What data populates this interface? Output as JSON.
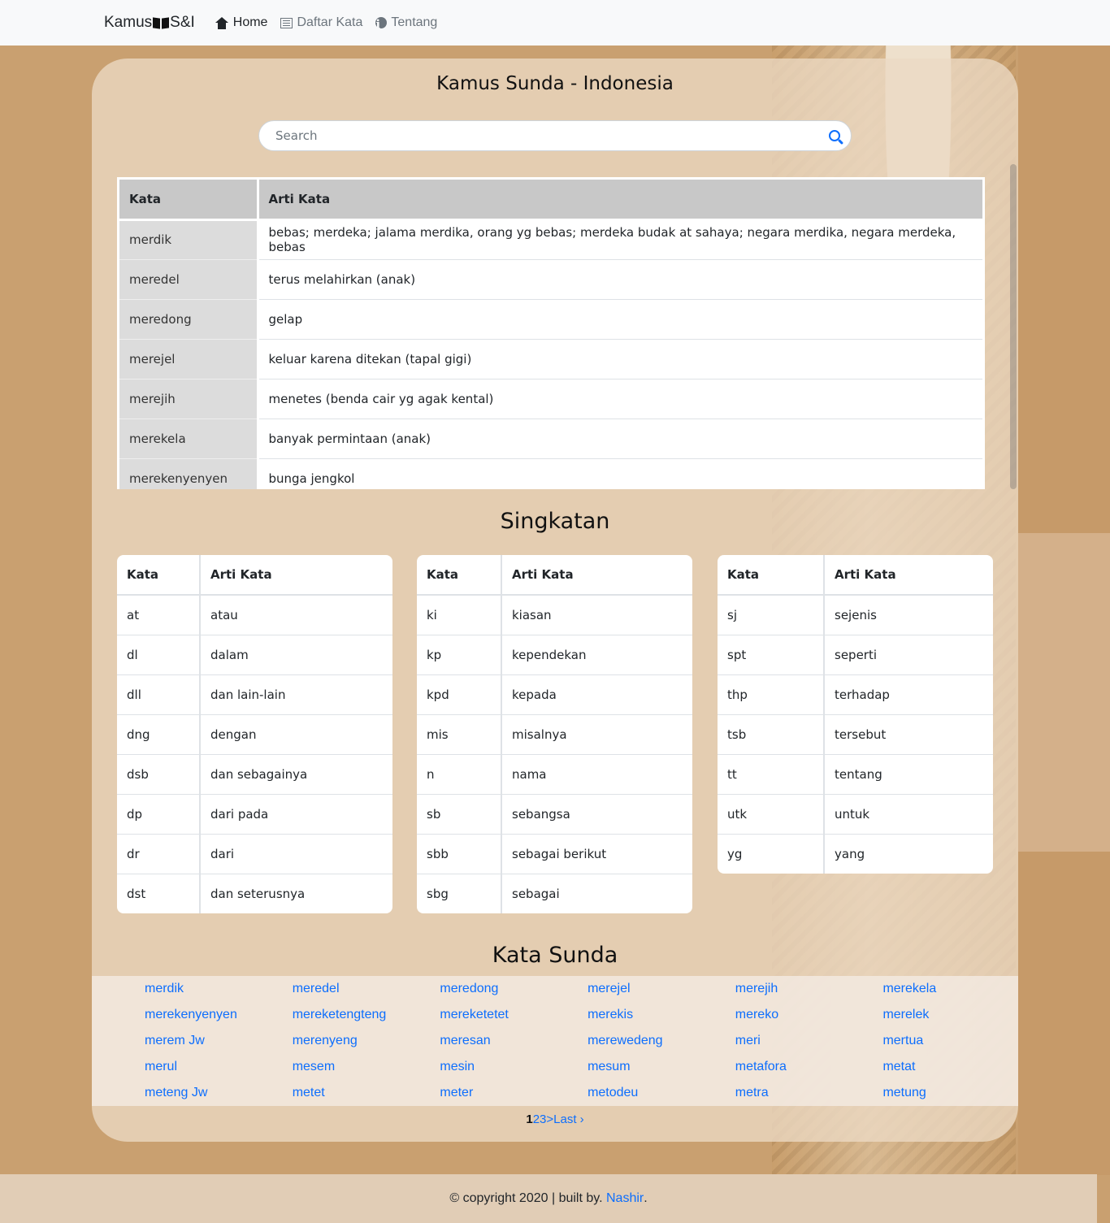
{
  "nav": {
    "brand_left": "Kamus",
    "brand_right": "S&I",
    "links": [
      {
        "label": "Home",
        "icon": "home-icon"
      },
      {
        "label": "Daftar Kata",
        "icon": "list-icon"
      },
      {
        "label": "Tentang",
        "icon": "info-icon"
      }
    ]
  },
  "main": {
    "title": "Kamus Sunda - Indonesia",
    "search_placeholder": "Search",
    "dict": {
      "headers": [
        "Kata",
        "Arti Kata"
      ],
      "rows": [
        [
          "merdik",
          "bebas; merdeka; jalama merdika, orang yg bebas; merdeka budak at sahaya; negara merdika, negara merdeka, bebas"
        ],
        [
          "meredel",
          "terus melahirkan (anak)"
        ],
        [
          "meredong",
          "gelap"
        ],
        [
          "merejel",
          "keluar karena ditekan (tapal gigi)"
        ],
        [
          "merejih",
          "menetes (benda cair yg agak kental)"
        ],
        [
          "merekela",
          "banyak permintaan (anak)"
        ],
        [
          "merekenyenyen",
          "bunga jengkol"
        ]
      ]
    }
  },
  "singkatan": {
    "title": "Singkatan",
    "headers": [
      "Kata",
      "Arti Kata"
    ],
    "tables": [
      [
        [
          "at",
          "atau"
        ],
        [
          "dl",
          "dalam"
        ],
        [
          "dll",
          "dan lain-lain"
        ],
        [
          "dng",
          "dengan"
        ],
        [
          "dsb",
          "dan sebagainya"
        ],
        [
          "dp",
          "dari pada"
        ],
        [
          "dr",
          "dari"
        ],
        [
          "dst",
          "dan seterusnya"
        ]
      ],
      [
        [
          "ki",
          "kiasan"
        ],
        [
          "kp",
          "kependekan"
        ],
        [
          "kpd",
          "kepada"
        ],
        [
          "mis",
          "misalnya"
        ],
        [
          "n",
          "nama"
        ],
        [
          "sb",
          "sebangsa"
        ],
        [
          "sbb",
          "sebagai berikut"
        ],
        [
          "sbg",
          "sebagai"
        ]
      ],
      [
        [
          "sj",
          "sejenis"
        ],
        [
          "spt",
          "seperti"
        ],
        [
          "thp",
          "terhadap"
        ],
        [
          "tsb",
          "tersebut"
        ],
        [
          "tt",
          "tentang"
        ],
        [
          "utk",
          "untuk"
        ],
        [
          "yg",
          "yang"
        ]
      ]
    ]
  },
  "kata_sunda": {
    "title": "Kata Sunda",
    "words": [
      "merdik",
      "meredel",
      "meredong",
      "merejel",
      "merejih",
      "merekela",
      "merekenyenyen",
      "mereketengteng",
      "mereketetet",
      "merekis",
      "mereko",
      "merelek",
      "merem Jw",
      "merenyeng",
      "meresan",
      "merewedeng",
      "meri",
      "mertua",
      "merul",
      "mesem",
      "mesin",
      "mesum",
      "metafora",
      "metat",
      "meteng Jw",
      "metet",
      "meter",
      "metodeu",
      "metra",
      "metung"
    ]
  },
  "pager": {
    "current": "1",
    "p2": "2",
    "p3": "3",
    "next": ">",
    "last": "Last ›"
  },
  "footer": {
    "text": "© copyright 2020 | built by. ",
    "author": "Nashir",
    "end": "."
  },
  "colors": {
    "accent": "#0d6efd",
    "page_bg": "#c9a070"
  }
}
